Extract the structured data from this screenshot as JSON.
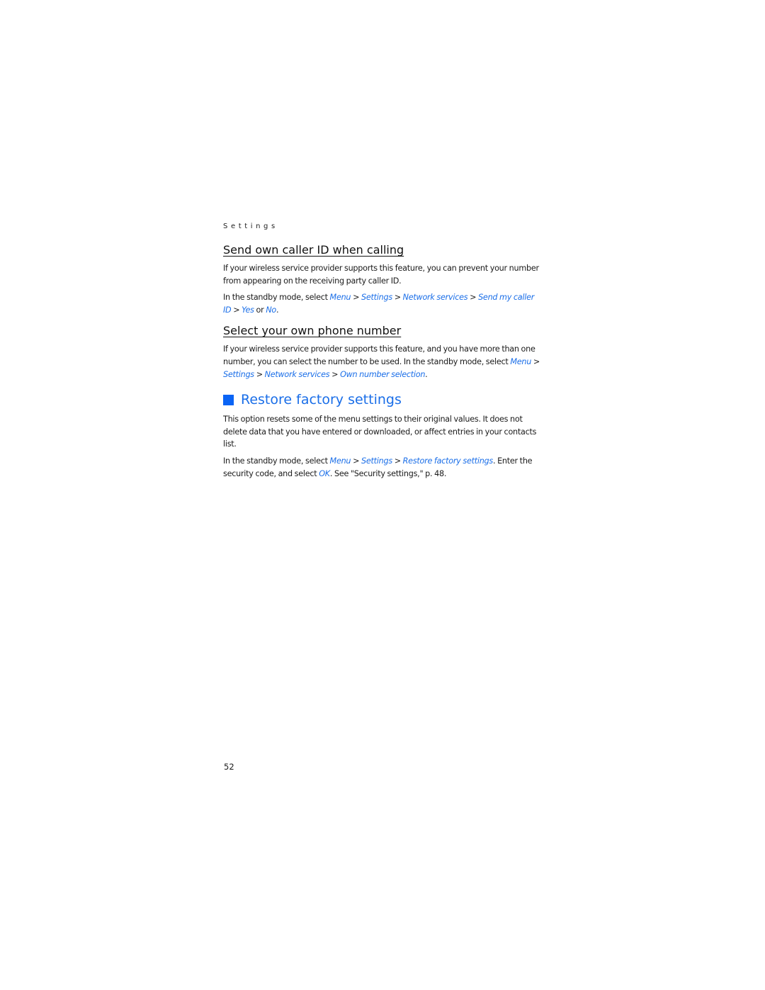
{
  "running_header": "Settings",
  "sections": [
    {
      "heading": "Send own caller ID when calling",
      "paragraph1": "If your wireless service provider supports this feature, you can prevent your number from appearing on the receiving party caller ID.",
      "paragraph2": {
        "prefix": "In the standby mode, select ",
        "path": [
          "Menu",
          "Settings",
          "Network services",
          "Send my caller ID"
        ],
        "options": [
          "Yes",
          "No"
        ],
        "or": " or ",
        "end": "."
      }
    },
    {
      "heading": "Select your own phone number",
      "paragraph1": {
        "text": "If your wireless service provider supports this feature, and you have more than one number, you can select the number to be used. In the standby mode, select ",
        "path": [
          "Menu",
          "Settings",
          "Network services",
          "Own number selection"
        ],
        "end": "."
      }
    }
  ],
  "main_section": {
    "heading": "Restore factory settings",
    "paragraph1": "This option resets some of the menu settings to their original values. It does not delete data that you have entered or downloaded, or affect entries in your contacts list.",
    "paragraph2": {
      "prefix": "In the standby mode, select ",
      "path": [
        "Menu",
        "Settings",
        "Restore factory settings"
      ],
      "middle": ". Enter the security code, and select ",
      "ok": "OK",
      "end": ". See \"Security settings,\" p. 48."
    }
  },
  "separator": " > ",
  "page_number": "52",
  "colors": {
    "link": "#1a6ee8",
    "accent_square": "#0a64f5"
  }
}
